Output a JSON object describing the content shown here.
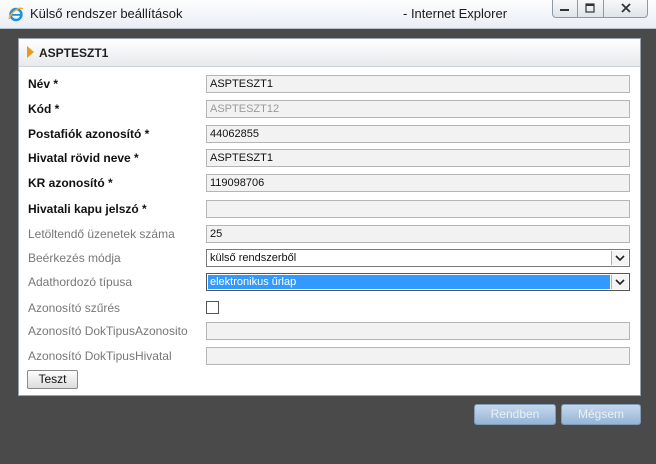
{
  "window": {
    "title": "Külső rendszer beállítások",
    "browser": "- Internet Explorer"
  },
  "panel": {
    "title": "ASPTESZT1"
  },
  "fields": [
    {
      "label": "Név *",
      "value": "ASPTESZT1",
      "required": true
    },
    {
      "label": "Kód *",
      "value": "ASPTESZT12",
      "required": true,
      "disabled": true
    },
    {
      "label": "Postafiók azonosító *",
      "value": "44062855",
      "required": true
    },
    {
      "label": "Hivatal rövid neve *",
      "value": "ASPTESZT1",
      "required": true
    },
    {
      "label": "KR azonosító *",
      "value": "119098706",
      "required": true
    },
    {
      "label": "Hivatali kapu jelszó *",
      "value": "",
      "required": true
    },
    {
      "label": "Letöltendő üzenetek száma",
      "value": "25"
    },
    {
      "label": "Beérkezés módja",
      "value": "külső rendszerből"
    },
    {
      "label": "Adathordozó típusa",
      "value": "elektronikus űrlap"
    },
    {
      "label": "Azonosító szűrés",
      "checked": false
    },
    {
      "label": "Azonosító DokTipusAzonosito",
      "value": ""
    },
    {
      "label": "Azonosító DokTipusHivatal",
      "value": ""
    }
  ],
  "buttons": {
    "teszt": "Teszt",
    "ok": "Rendben",
    "cancel": "Mégsem"
  },
  "colors": {
    "accent": "#3399ff",
    "header_arrow": "#e89b1a",
    "backdrop": "#4a4a4a"
  }
}
